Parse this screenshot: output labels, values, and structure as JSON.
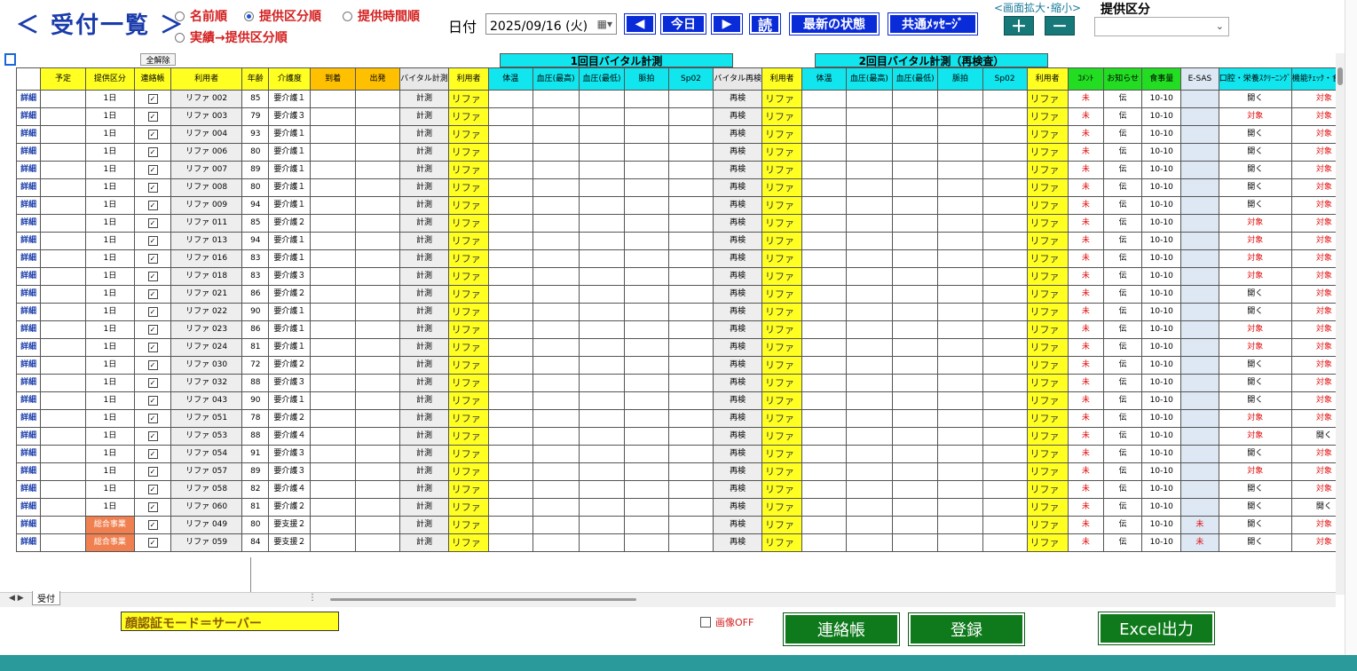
{
  "header": {
    "title": "＜ 受付一覧 ＞",
    "sort_options": [
      {
        "label": "名前順",
        "selected": false
      },
      {
        "label": "提供区分順",
        "selected": true
      },
      {
        "label": "提供時間順",
        "selected": false
      },
      {
        "label": "実績→提供区分順",
        "selected": false
      }
    ],
    "date_label": "日付",
    "date_value": "2025/09/16 (火)",
    "prev_label": "◀",
    "today_label": "今日",
    "next_label": "▶",
    "read_label": "読",
    "latest_label": "最新の状態",
    "message_label": "共通ﾒｯｾｰｼﾞ",
    "zoom_label": "<画面拡大･縮小>",
    "zoom_in": "＋",
    "zoom_out": "－",
    "teikyo_label": "提供区分",
    "teikyo_value": ""
  },
  "table": {
    "unselect_all": "全解除",
    "group1_title": "1回目バイタル計測",
    "group2_title": "2回目バイタル計測（再検査）",
    "columns": [
      "予定",
      "提供区分",
      "連絡帳",
      "利用者",
      "年齢",
      "介護度",
      "到着",
      "出発",
      "バイタル計測",
      "利用者",
      "体温",
      "血圧(最高)",
      "血圧(最低)",
      "脈拍",
      "Sp02",
      "バイタル再検",
      "利用者",
      "体温",
      "血圧(最高)",
      "血圧(最低)",
      "脈拍",
      "Sp02",
      "利用者",
      "ｺﾒﾝﾄ",
      "お知らせ",
      "食事量",
      "E-SAS",
      "口腔・栄養ｽｸﾘｰﾆﾝｸﾞ",
      "機能ﾁｪｯｸ・食習慣"
    ],
    "detail_label": "詳細",
    "measure_label": "計測",
    "recheck_label": "再検",
    "user_short": "リファ",
    "comment_mark": "未",
    "notice_mark": "伝",
    "meal_value": "10-10",
    "rows": [
      {
        "kubun": "1日",
        "user": "リファ 002",
        "age": "85",
        "care": "要介護１",
        "esas": "",
        "oral": "開く",
        "func": "対象"
      },
      {
        "kubun": "1日",
        "user": "リファ 003",
        "age": "79",
        "care": "要介護３",
        "esas": "",
        "oral": "対象",
        "func": "対象"
      },
      {
        "kubun": "1日",
        "user": "リファ 004",
        "age": "93",
        "care": "要介護１",
        "esas": "",
        "oral": "開く",
        "func": "対象"
      },
      {
        "kubun": "1日",
        "user": "リファ 006",
        "age": "80",
        "care": "要介護１",
        "esas": "",
        "oral": "開く",
        "func": "対象"
      },
      {
        "kubun": "1日",
        "user": "リファ 007",
        "age": "89",
        "care": "要介護１",
        "esas": "",
        "oral": "開く",
        "func": "対象"
      },
      {
        "kubun": "1日",
        "user": "リファ 008",
        "age": "80",
        "care": "要介護１",
        "esas": "",
        "oral": "開く",
        "func": "対象"
      },
      {
        "kubun": "1日",
        "user": "リファ 009",
        "age": "94",
        "care": "要介護１",
        "esas": "",
        "oral": "開く",
        "func": "対象"
      },
      {
        "kubun": "1日",
        "user": "リファ 011",
        "age": "85",
        "care": "要介護２",
        "esas": "",
        "oral": "対象",
        "func": "対象"
      },
      {
        "kubun": "1日",
        "user": "リファ 013",
        "age": "94",
        "care": "要介護１",
        "esas": "",
        "oral": "対象",
        "func": "対象"
      },
      {
        "kubun": "1日",
        "user": "リファ 016",
        "age": "83",
        "care": "要介護１",
        "esas": "",
        "oral": "対象",
        "func": "対象"
      },
      {
        "kubun": "1日",
        "user": "リファ 018",
        "age": "83",
        "care": "要介護３",
        "esas": "",
        "oral": "対象",
        "func": "対象"
      },
      {
        "kubun": "1日",
        "user": "リファ 021",
        "age": "86",
        "care": "要介護２",
        "esas": "",
        "oral": "開く",
        "func": "対象"
      },
      {
        "kubun": "1日",
        "user": "リファ 022",
        "age": "90",
        "care": "要介護１",
        "esas": "",
        "oral": "開く",
        "func": "対象"
      },
      {
        "kubun": "1日",
        "user": "リファ 023",
        "age": "86",
        "care": "要介護１",
        "esas": "",
        "oral": "対象",
        "func": "対象"
      },
      {
        "kubun": "1日",
        "user": "リファ 024",
        "age": "81",
        "care": "要介護１",
        "esas": "",
        "oral": "対象",
        "func": "対象"
      },
      {
        "kubun": "1日",
        "user": "リファ 030",
        "age": "72",
        "care": "要介護２",
        "esas": "",
        "oral": "開く",
        "func": "対象"
      },
      {
        "kubun": "1日",
        "user": "リファ 032",
        "age": "88",
        "care": "要介護３",
        "esas": "",
        "oral": "開く",
        "func": "対象"
      },
      {
        "kubun": "1日",
        "user": "リファ 043",
        "age": "90",
        "care": "要介護１",
        "esas": "",
        "oral": "開く",
        "func": "対象"
      },
      {
        "kubun": "1日",
        "user": "リファ 051",
        "age": "78",
        "care": "要介護２",
        "esas": "",
        "oral": "対象",
        "func": "対象"
      },
      {
        "kubun": "1日",
        "user": "リファ 053",
        "age": "88",
        "care": "要介護４",
        "esas": "",
        "oral": "対象",
        "func": "開く"
      },
      {
        "kubun": "1日",
        "user": "リファ 054",
        "age": "91",
        "care": "要介護３",
        "esas": "",
        "oral": "開く",
        "func": "対象"
      },
      {
        "kubun": "1日",
        "user": "リファ 057",
        "age": "89",
        "care": "要介護３",
        "esas": "",
        "oral": "対象",
        "func": "対象"
      },
      {
        "kubun": "1日",
        "user": "リファ 058",
        "age": "82",
        "care": "要介護４",
        "esas": "",
        "oral": "開く",
        "func": "対象"
      },
      {
        "kubun": "1日",
        "user": "リファ 060",
        "age": "81",
        "care": "要介護２",
        "esas": "",
        "oral": "開く",
        "func": "開く"
      },
      {
        "kubun": "総合事業",
        "user": "リファ 049",
        "age": "80",
        "care": "要支援２",
        "esas": "未",
        "oral": "開く",
        "func": "対象"
      },
      {
        "kubun": "総合事業",
        "user": "リファ 059",
        "age": "84",
        "care": "要支援２",
        "esas": "未",
        "oral": "開く",
        "func": "対象"
      }
    ]
  },
  "footer": {
    "sheet_tab": "受付",
    "face_auth_label": "顔認証モード＝サーバー",
    "image_off_label": "画像OFF",
    "contact_book_button": "連絡帳",
    "register_button": "登録",
    "excel_button": "Excel出力"
  },
  "colors": {
    "title_blue": "#1a3caa",
    "radio_red": "#d42020",
    "header_yellow": "#ffff22",
    "header_orange": "#ffc000",
    "header_cyan": "#11e6ee",
    "header_green": "#22dd22",
    "button_blue": "#0a2bd8",
    "button_teal": "#167878",
    "button_green": "#0e7a1c",
    "sogo_orange": "#f08050"
  }
}
